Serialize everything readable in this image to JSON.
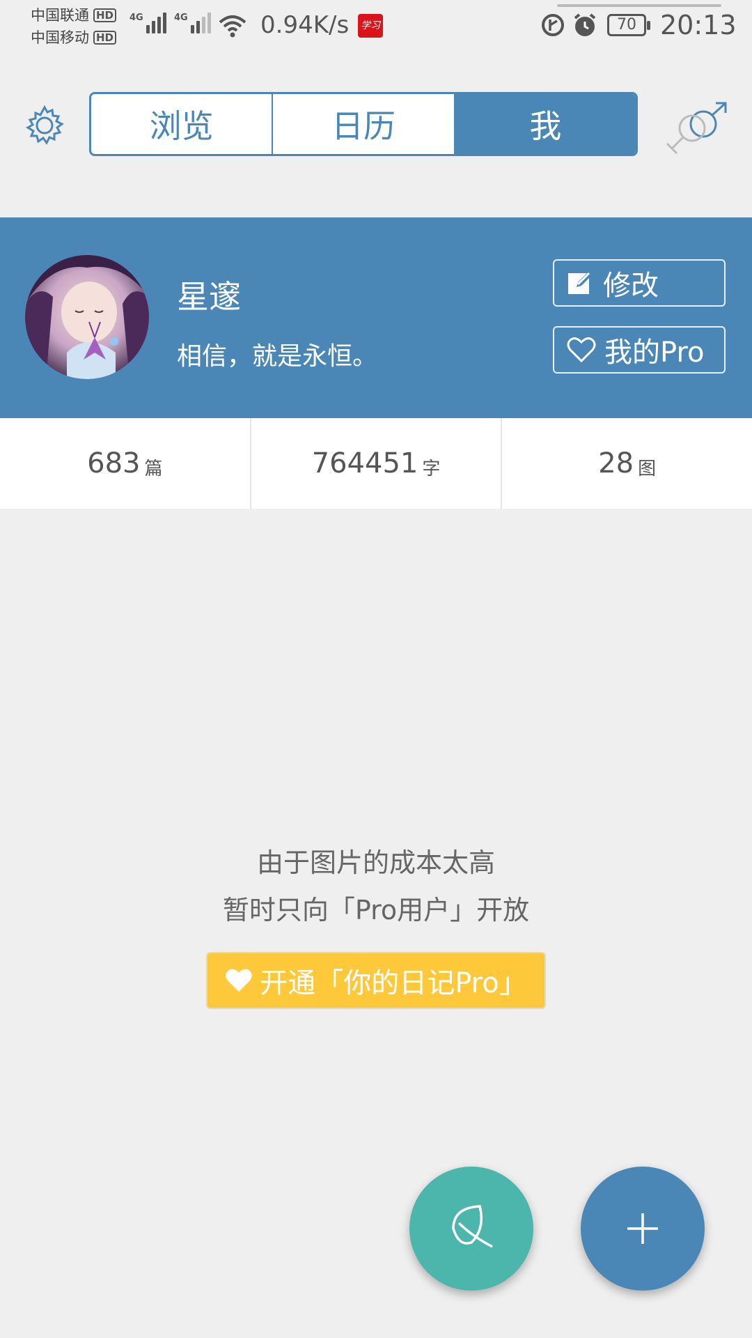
{
  "status_bar": {
    "carrier_1": "中国联通",
    "carrier_2": "中国移动",
    "hd_label": "HD",
    "network_label": "4G",
    "net_speed": "0.94K/s",
    "app_notification_text": "学习",
    "battery_level": "70",
    "time": "20:13"
  },
  "header": {
    "tabs": [
      {
        "label": "浏览",
        "active": false
      },
      {
        "label": "日历",
        "active": false
      },
      {
        "label": "我",
        "active": true
      }
    ],
    "settings_icon": "gear-icon",
    "gender_icon": "gender-male-female-icon"
  },
  "profile": {
    "name": "星邃",
    "motto": "相信，就是永恒。",
    "edit_label": "修改",
    "pro_label": "我的Pro"
  },
  "stats": [
    {
      "value": "683",
      "unit": "篇"
    },
    {
      "value": "764451",
      "unit": "字"
    },
    {
      "value": "28",
      "unit": "图"
    }
  ],
  "notice": {
    "line1": "由于图片的成本太高",
    "line2": "暂时只向「Pro用户」开放",
    "upgrade_label": "开通「你的日记Pro」"
  },
  "fabs": {
    "leaf_icon": "leaf-icon",
    "add_icon": "plus-icon"
  },
  "colors": {
    "primary": "#4a86b6",
    "accent_teal": "#4db6ac",
    "pro_yellow": "#fdc93a",
    "background": "#efefef"
  }
}
